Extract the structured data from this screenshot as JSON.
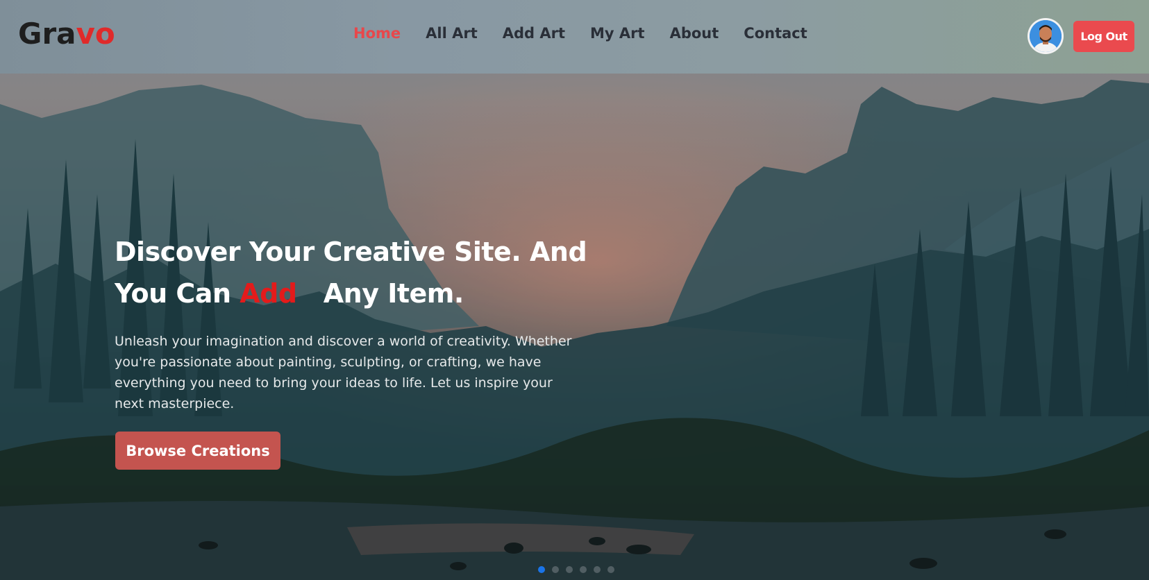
{
  "brand": {
    "logo_main": "Gra",
    "logo_accent": "vo"
  },
  "nav": {
    "items": [
      {
        "label": "Home",
        "active": true
      },
      {
        "label": "All Art",
        "active": false
      },
      {
        "label": "Add Art",
        "active": false
      },
      {
        "label": "My Art",
        "active": false
      },
      {
        "label": "About",
        "active": false
      },
      {
        "label": "Contact",
        "active": false
      }
    ]
  },
  "header": {
    "logout_label": "Log Out",
    "avatar_icon": "user-avatar"
  },
  "hero": {
    "headline_part1": "Discover Your Creative Site. And",
    "headline_part2": "You Can",
    "headline_accent": "Add",
    "headline_part3": "Any Item.",
    "description": "Unleash your imagination and discover a world of creativity. Whether you're passionate about painting, sculpting, or crafting, we have everything you need to bring your ideas to life. Let us inspire your next masterpiece.",
    "cta_label": "Browse Creations"
  },
  "carousel": {
    "slide_count": 6,
    "active_index": 0
  },
  "colors": {
    "accent": "#e8474b",
    "cta": "#c4544f",
    "logout": "#ea4a4e",
    "dot_active": "#1a74e8"
  }
}
